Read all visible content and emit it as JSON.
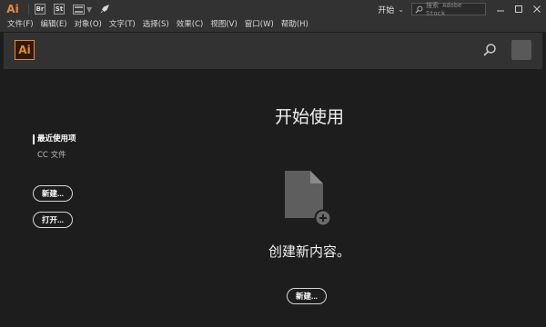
{
  "titlebar": {
    "app_logo": "Ai",
    "bridge_label": "Br",
    "stock_label": "St",
    "workspace_label": "开始",
    "stock_search_placeholder": "搜索 Adobe Stock"
  },
  "menu": [
    "文件(F)",
    "编辑(E)",
    "对象(O)",
    "文字(T)",
    "选择(S)",
    "效果(C)",
    "视图(V)",
    "窗口(W)",
    "帮助(H)"
  ],
  "header": {
    "logo": "Ai"
  },
  "left_nav": {
    "recent_label": "最近使用项",
    "cc_files_label": "CC 文件",
    "new_button": "新建...",
    "open_button": "打开..."
  },
  "content": {
    "title": "开始使用",
    "create_text": "创建新内容。",
    "new_button": "新建..."
  },
  "colors": {
    "accent": "#f08a24",
    "chrome": "#323232",
    "background": "#1d1d1d"
  },
  "icons": {
    "search": "search-icon",
    "rocket": "rocket-icon",
    "new_document": "new-document-icon",
    "minimize": "minimize-icon",
    "maximize": "maximize-icon",
    "close": "close-icon"
  }
}
